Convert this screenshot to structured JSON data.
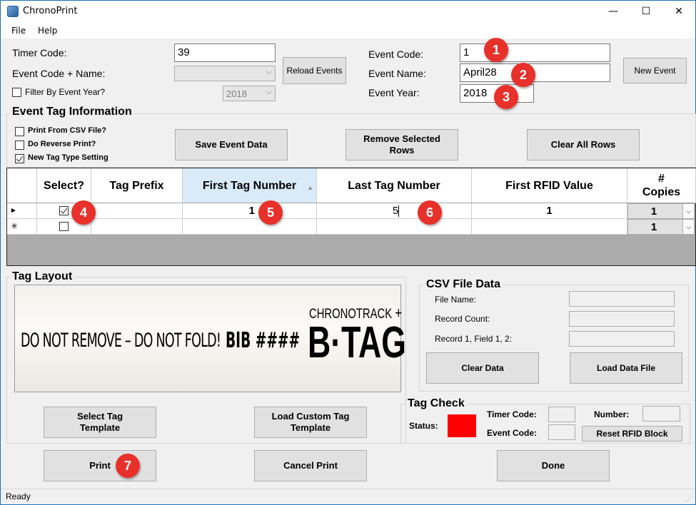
{
  "window": {
    "title": "ChronoPrint",
    "minimize": "—",
    "maximize": "☐",
    "close": "✕"
  },
  "menu": {
    "file": "File",
    "help": "Help"
  },
  "top_left": {
    "timer_code_label": "Timer Code:",
    "timer_code_value": "39",
    "event_code_name_label": "Event Code + Name:",
    "event_code_name_value": "",
    "filter_label": "Filter By Event Year?",
    "filter_year": "2018",
    "reload_button": "Reload Events"
  },
  "top_right": {
    "event_code_label": "Event Code:",
    "event_code_value": "1",
    "event_name_label": "Event Name:",
    "event_name_value": "April28",
    "event_year_label": "Event Year:",
    "event_year_value": "2018",
    "new_event_button": "New Event"
  },
  "event_tag_info": {
    "title": "Event Tag Information",
    "print_from_csv": "Print From CSV File?",
    "do_reverse_print": "Do Reverse Print?",
    "new_tag_type": "New Tag Type Setting",
    "save_button": "Save Event Data",
    "remove_button": "Remove Selected Rows",
    "clear_button": "Clear All Rows"
  },
  "grid": {
    "columns": [
      "Select?",
      "Tag Prefix",
      "First Tag Number",
      "Last Tag Number",
      "First RFID Value",
      "# Copies"
    ],
    "rows": [
      {
        "indicator": "▸",
        "selected": true,
        "prefix": "",
        "first": "1",
        "last": "5",
        "rfid": "1",
        "copies": "1"
      },
      {
        "indicator": "✳",
        "selected": false,
        "prefix": "",
        "first": "",
        "last": "",
        "rfid": "",
        "copies": "1"
      }
    ]
  },
  "tag_layout": {
    "title": "Tag Layout",
    "tag_text_main": "DO NOT REMOVE – DO NOT FOLD!",
    "tag_text_bib": "BIB ####",
    "logo_top": "CHRONOTRACK",
    "logo_bottom": "B·TAG",
    "select_template_button": "Select Tag Template",
    "load_custom_button": "Load Custom Tag Template"
  },
  "csv": {
    "title": "CSV File Data",
    "file_name_label": "File Name:",
    "record_count_label": "Record Count:",
    "record1_label": "Record 1, Field 1, 2:",
    "clear_button": "Clear Data",
    "load_button": "Load Data File"
  },
  "tag_check": {
    "title": "Tag Check",
    "status_label": "Status:",
    "status_color": "#ff0000",
    "timer_code_label": "Timer Code:",
    "event_code_label": "Event Code:",
    "number_label": "Number:",
    "reset_button": "Reset RFID Block"
  },
  "bottom": {
    "print_button": "Print",
    "cancel_button": "Cancel Print",
    "done_button": "Done"
  },
  "status": {
    "text": "Ready"
  },
  "annotations": [
    "1",
    "2",
    "3",
    "4",
    "5",
    "6",
    "7"
  ],
  "colors": {
    "badge": "#e8312a",
    "sorted_header": "#d9ebf9",
    "grid_background": "#ababab"
  }
}
